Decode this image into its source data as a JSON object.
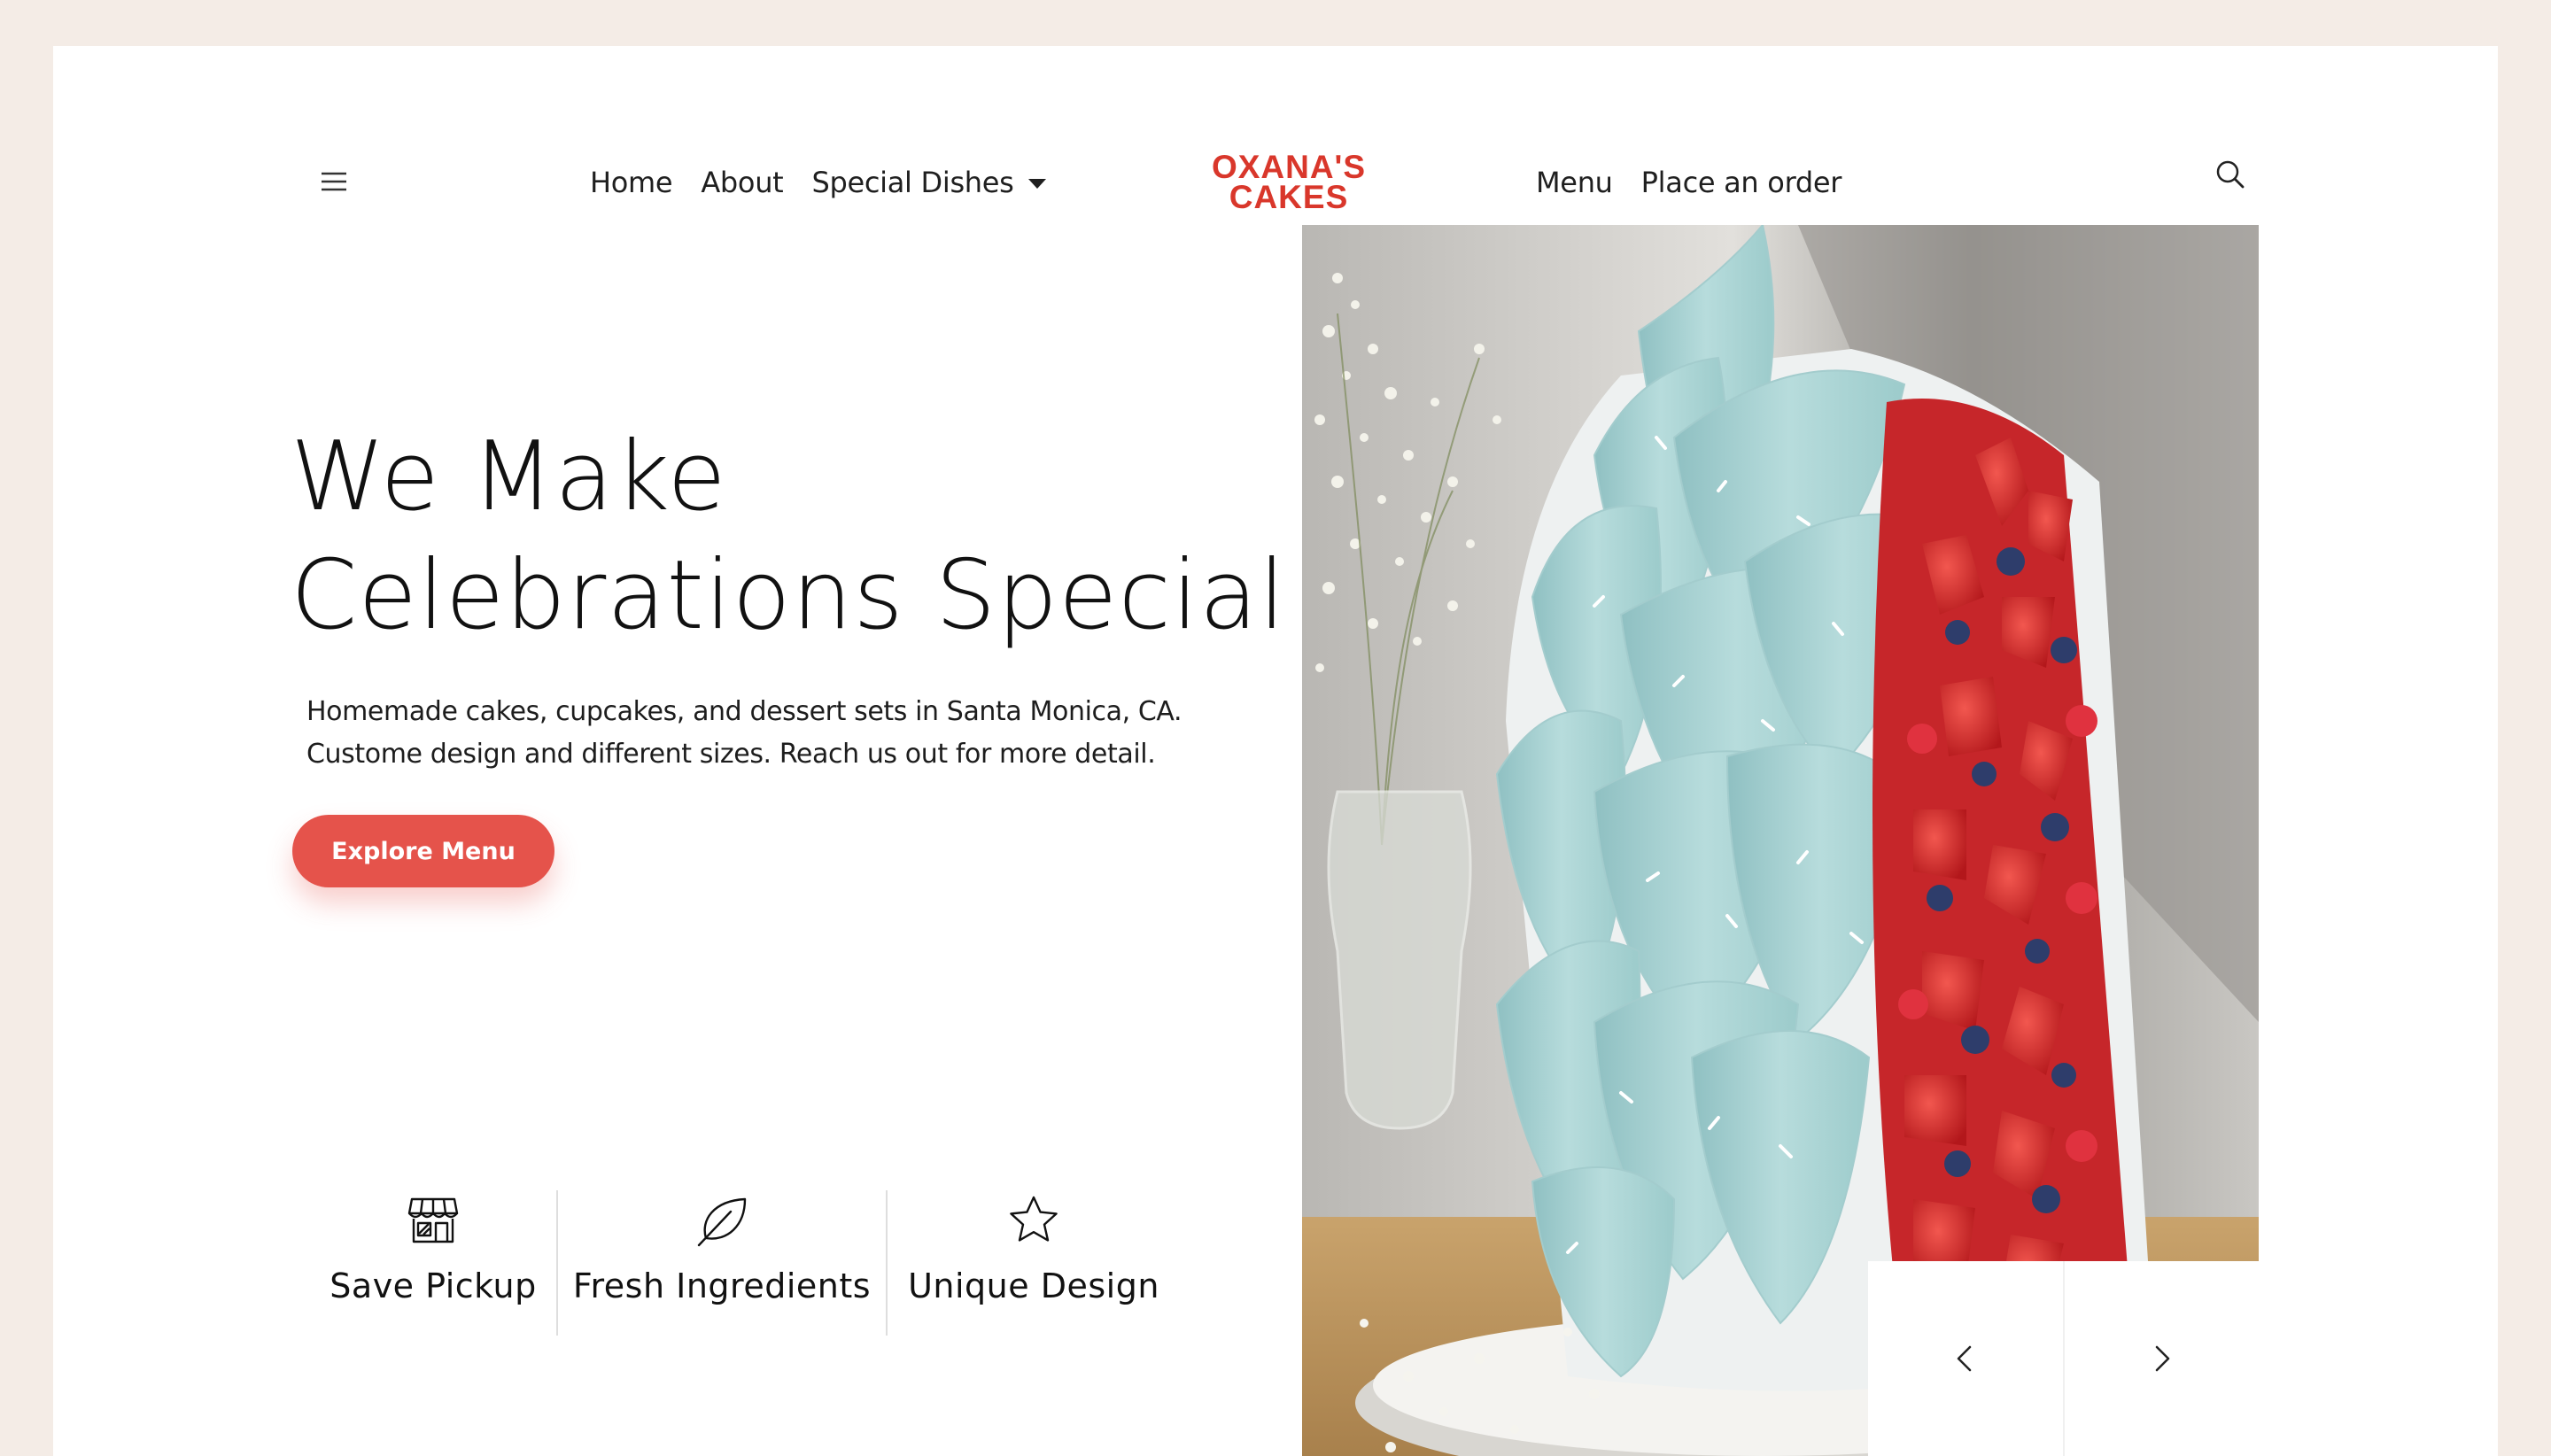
{
  "brand": {
    "line1": "OXANA'S",
    "line2": "CAKES",
    "color": "#d9372b"
  },
  "nav": {
    "menu_icon": "hamburger-icon",
    "left_items": [
      {
        "label": "Home"
      },
      {
        "label": "About"
      },
      {
        "label": "Special Dishes",
        "has_dropdown": true
      }
    ],
    "right_items": [
      {
        "label": "Menu"
      },
      {
        "label": "Place an order"
      }
    ],
    "search_icon": "search-icon"
  },
  "hero": {
    "title_line1": "We Make",
    "title_line2": "Celebrations Special",
    "subtitle_line1": "Homemade cakes, cupcakes, and dessert sets in Santa Monica, CA.",
    "subtitle_line2": "Custome design and different sizes. Reach us out for more detail.",
    "cta_label": "Explore Menu",
    "accent_color": "#e5534b"
  },
  "features": [
    {
      "icon": "storefront-icon",
      "label": "Save Pickup"
    },
    {
      "icon": "leaf-icon",
      "label": "Fresh Ingredients"
    },
    {
      "icon": "star-icon",
      "label": "Unique Design"
    }
  ],
  "carousel": {
    "prev_icon": "chevron-left-icon",
    "next_icon": "chevron-right-icon"
  }
}
